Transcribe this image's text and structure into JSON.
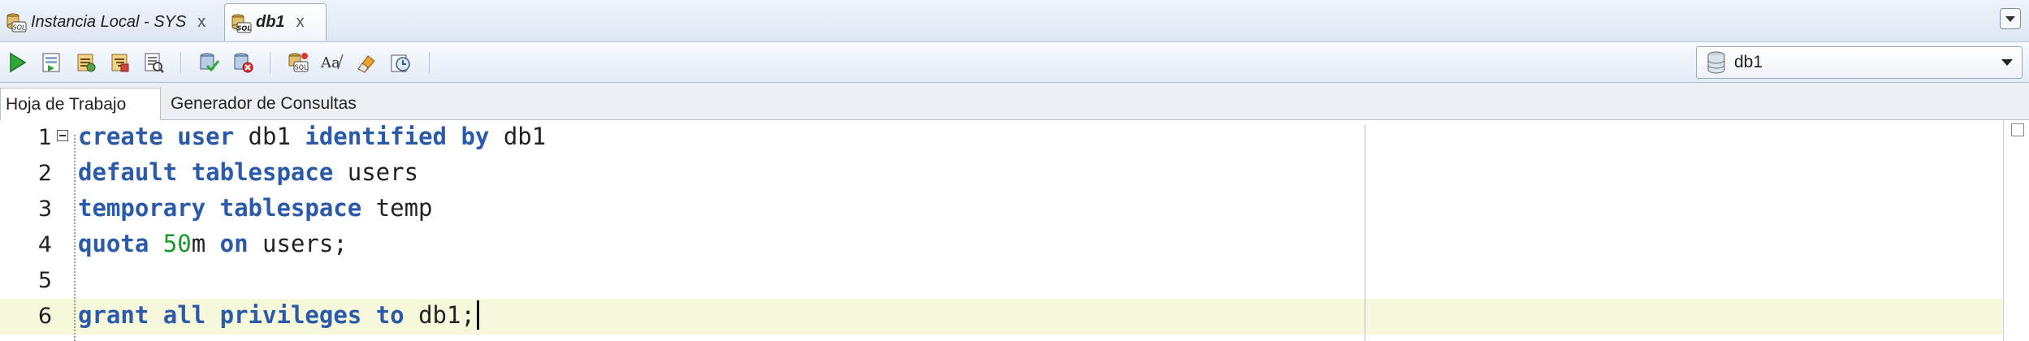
{
  "tabs": [
    {
      "label": "Instancia Local - SYS",
      "close": "x",
      "active": false,
      "icon": "sql-connection-icon"
    },
    {
      "label": "db1",
      "close": "x",
      "active": true,
      "icon": "sql-connection-icon"
    }
  ],
  "toolbar": {
    "buttons": [
      {
        "name": "run-statement-icon"
      },
      {
        "name": "run-script-icon"
      },
      {
        "name": "autotrace-icon"
      },
      {
        "name": "explain-plan-icon"
      },
      {
        "name": "sql-tuning-icon"
      },
      {
        "name": "commit-icon"
      },
      {
        "name": "rollback-icon"
      },
      {
        "name": "unshared-sql-worksheet-icon"
      },
      {
        "name": "to-upper-lower-icon"
      },
      {
        "name": "clear-icon"
      },
      {
        "name": "sql-history-icon"
      }
    ],
    "connection": "db1"
  },
  "subtabs": {
    "worksheet": "Hoja de Trabajo",
    "query_builder": "Generador de Consultas"
  },
  "editor": {
    "current_line": 6,
    "lines": [
      {
        "n": "1",
        "tokens": [
          {
            "t": "create",
            "k": true
          },
          {
            "t": " "
          },
          {
            "t": "user",
            "k": true
          },
          {
            "t": " db1 "
          },
          {
            "t": "identified",
            "k": true
          },
          {
            "t": " "
          },
          {
            "t": "by",
            "k": true
          },
          {
            "t": " db1"
          }
        ]
      },
      {
        "n": "2",
        "tokens": [
          {
            "t": "default",
            "k": true
          },
          {
            "t": " "
          },
          {
            "t": "tablespace",
            "k": true
          },
          {
            "t": " users"
          }
        ]
      },
      {
        "n": "3",
        "tokens": [
          {
            "t": "temporary",
            "k": true
          },
          {
            "t": " "
          },
          {
            "t": "tablespace",
            "k": true
          },
          {
            "t": " temp"
          }
        ]
      },
      {
        "n": "4",
        "tokens": [
          {
            "t": "quota",
            "k": true
          },
          {
            "t": " "
          },
          {
            "t": "50",
            "num": true
          },
          {
            "t": "m "
          },
          {
            "t": "on",
            "k": true
          },
          {
            "t": " users;"
          }
        ]
      },
      {
        "n": "5",
        "tokens": []
      },
      {
        "n": "6",
        "tokens": [
          {
            "t": "grant",
            "k": true
          },
          {
            "t": " "
          },
          {
            "t": "all",
            "k": true
          },
          {
            "t": " "
          },
          {
            "t": "privileges",
            "k": true
          },
          {
            "t": " "
          },
          {
            "t": "to",
            "k": true
          },
          {
            "t": " db1;"
          }
        ]
      }
    ]
  },
  "colors": {
    "keyword": "#2a5aa8",
    "number": "#169a2a",
    "current_line_bg": "#f7f7dc"
  }
}
